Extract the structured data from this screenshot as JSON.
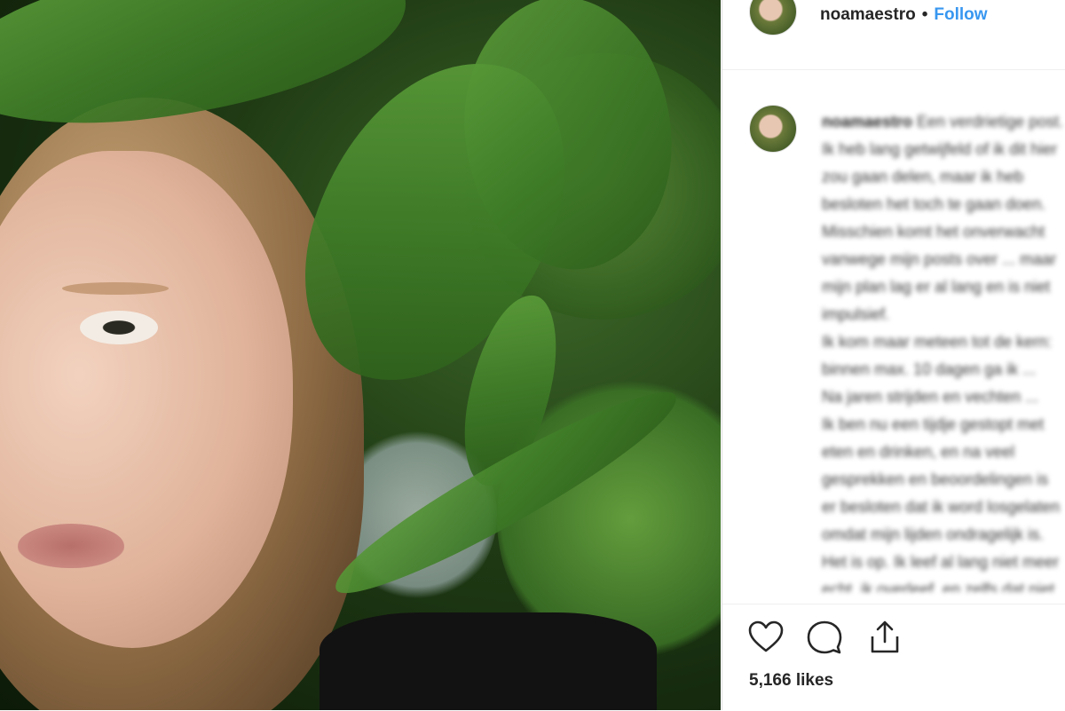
{
  "post": {
    "username": "noamaestro",
    "separator": "•",
    "follow_label": "Follow",
    "caption": {
      "username": "noamaestro",
      "text": "Een verdrietige post. Ik heb lang getwijfeld of ik dit hier zou gaan delen, maar ik heb besloten het toch te gaan doen. Misschien komt het onverwacht vanwege mijn posts over ... maar mijn plan lag er al lang en is niet impulsief.\nIk kom maar meteen tot de kern: binnen max. 10 dagen ga ik ...\nNa jaren strijden en vechten ...\nIk ben nu een tijdje gestopt met eten en drinken, en na veel gesprekken en beoordelingen is er besloten dat ik word losgelaten omdat mijn lijden ondragelijk is. Het is op. Ik leef al lang niet meer echt, ik overleef, en zelfs dat niet echt. Ik adem ..."
    },
    "likes_text": "5,166 likes"
  },
  "icons": {
    "like": "heart-icon",
    "comment": "comment-bubble-icon",
    "share": "share-upload-icon"
  },
  "colors": {
    "link_blue": "#3897f0",
    "text_dark": "#262626",
    "border": "#dbdbdb"
  }
}
